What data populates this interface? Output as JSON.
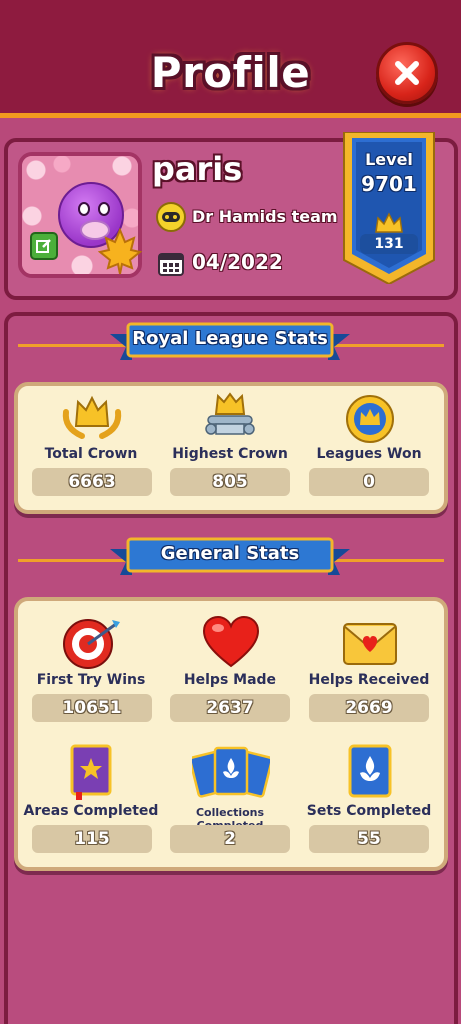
{
  "header": {
    "title": "Profile",
    "close_icon": "close-icon"
  },
  "profile": {
    "username": "paris",
    "team_name": "Dr Hamids team",
    "join_date": "04/2022",
    "level_label": "Level",
    "level_value": "9701",
    "crowns": "131"
  },
  "royal_league": {
    "title": "Royal League Stats",
    "stats": [
      {
        "label": "Total Crown",
        "value": "6663",
        "icon": "laurel-crown-icon"
      },
      {
        "label": "Highest Crown",
        "value": "805",
        "icon": "pedestal-crown-icon"
      },
      {
        "label": "Leagues Won",
        "value": "0",
        "icon": "crown-medal-icon"
      }
    ]
  },
  "general": {
    "title": "General Stats",
    "stats": [
      {
        "label": "First Try Wins",
        "value": "10651",
        "icon": "target-arrow-icon"
      },
      {
        "label": "Helps Made",
        "value": "2637",
        "icon": "heart-icon"
      },
      {
        "label": "Helps Received",
        "value": "2669",
        "icon": "envelope-heart-icon"
      },
      {
        "label": "Areas Completed",
        "value": "115",
        "icon": "star-book-icon"
      },
      {
        "label": "Collections Completed",
        "value": "2",
        "icon": "card-fan-icon"
      },
      {
        "label": "Sets Completed",
        "value": "55",
        "icon": "fleur-card-icon"
      }
    ]
  },
  "colors": {
    "header_bg": "#8e1b3f",
    "panel_bg": "#b94c7e",
    "card_bg": "#fbf1cf",
    "ribbon_blue": "#1d5bb5",
    "accent_orange": "#f29a1e"
  }
}
